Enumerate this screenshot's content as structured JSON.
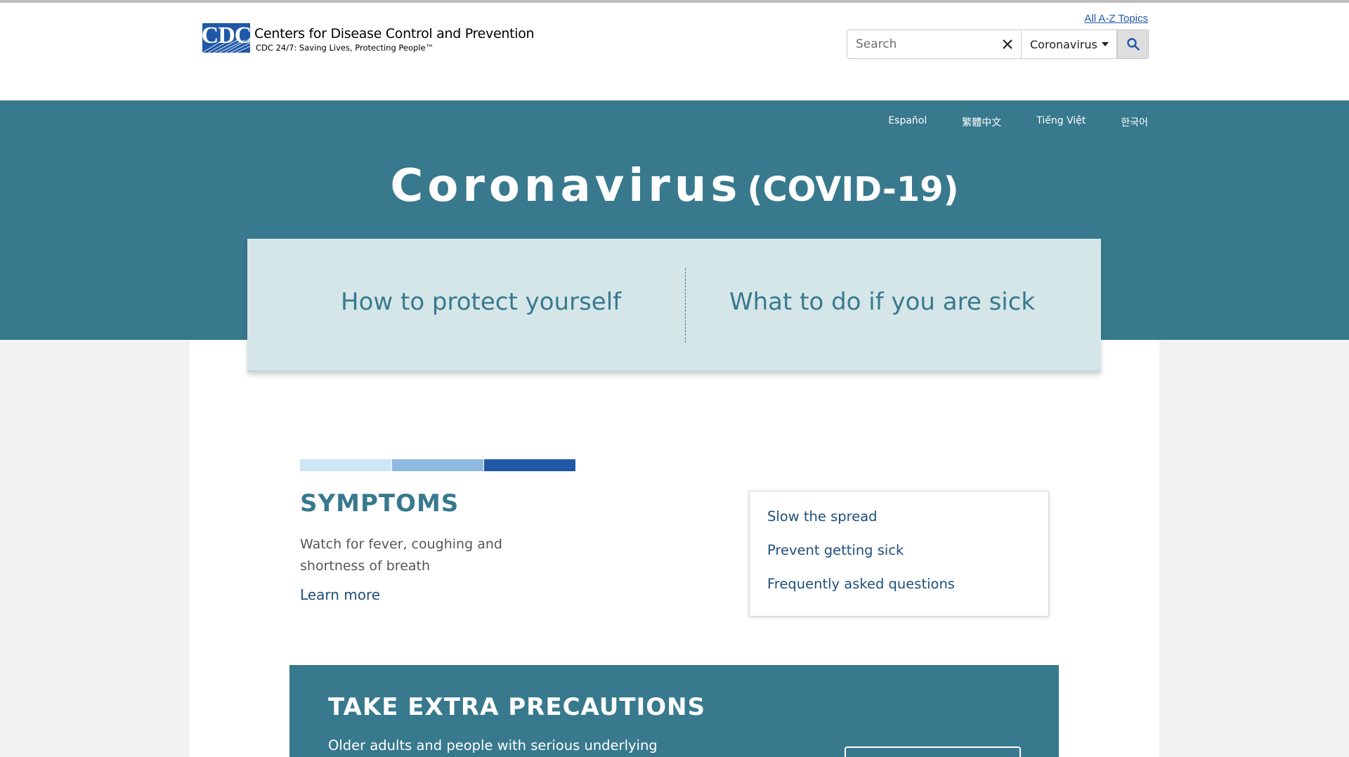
{
  "header": {
    "org_abbrev": "CDC",
    "org_name": "Centers for Disease Control and Prevention",
    "tagline": "CDC 24/7: Saving Lives, Protecting People™",
    "az_link": "All A-Z Topics",
    "search": {
      "placeholder": "Search",
      "value": "",
      "scope": "Coronavirus"
    },
    "icons": [
      "cdc-logo",
      "close-icon",
      "chevron-down-icon",
      "search-icon"
    ]
  },
  "languages": [
    "Español",
    "繁體中文",
    "Tiếng Việt",
    "한국어"
  ],
  "hero": {
    "title": "Coronavirus",
    "subtitle": "(COVID-19)"
  },
  "callout": {
    "left_link": "How to protect yourself",
    "right_link": "What to do if you are sick"
  },
  "symptoms": {
    "accent_colors": [
      "#cde6f5",
      "#8fb9e0",
      "#1f58a6"
    ],
    "title": "SYMPTOMS",
    "description": "Watch for fever, coughing and shortness of breath",
    "learn_more": "Learn more"
  },
  "quick_links": [
    "Slow the spread",
    "Prevent getting sick",
    "Frequently asked questions"
  ],
  "precautions": {
    "title": "TAKE EXTRA PRECAUTIONS",
    "description": "Older adults and people with serious underlying"
  },
  "colors": {
    "brand_teal": "#38798e",
    "callout_bg": "#d5e6e9",
    "link_blue": "#1f4f7a",
    "cdc_blue": "#1f58a6"
  }
}
